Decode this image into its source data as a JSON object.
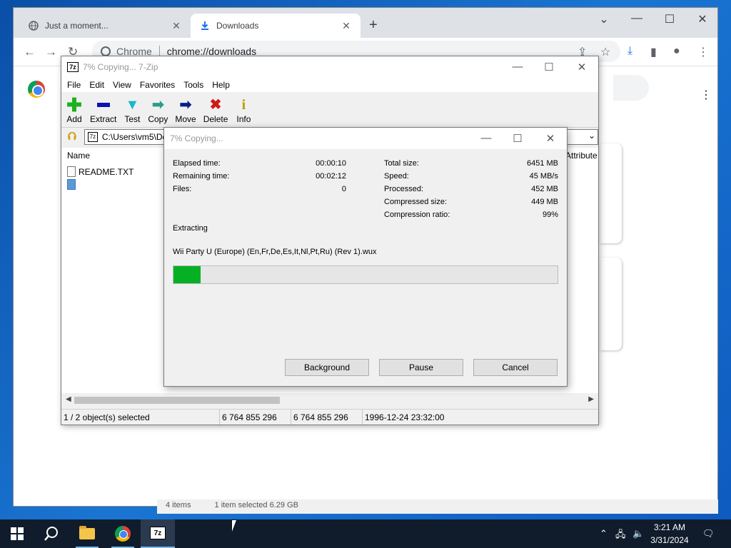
{
  "chrome": {
    "tabs": [
      {
        "label": "Just a moment...",
        "icon": "globe-icon",
        "active": false
      },
      {
        "label": "Downloads",
        "icon": "download-icon",
        "active": true
      }
    ],
    "site_label": "Chrome",
    "url": "chrome://downloads"
  },
  "explorer_behind": {
    "items": "4 items",
    "selected": "1 item selected  6.29 GB"
  },
  "zip": {
    "title": "7% Copying... 7-Zip",
    "menu": [
      "File",
      "Edit",
      "View",
      "Favorites",
      "Tools",
      "Help"
    ],
    "toolbar": [
      {
        "label": "Add",
        "icon": "add-icon",
        "color": "#1db21d"
      },
      {
        "label": "Extract",
        "icon": "extract-icon",
        "color": "#0a14b4"
      },
      {
        "label": "Test",
        "icon": "test-icon",
        "color": "#17b9c9"
      },
      {
        "label": "Copy",
        "icon": "copy-icon",
        "color": "#2f9c8a"
      },
      {
        "label": "Move",
        "icon": "move-icon",
        "color": "#0a1d8a"
      },
      {
        "label": "Delete",
        "icon": "delete-icon",
        "color": "#d01818"
      },
      {
        "label": "Info",
        "icon": "info-icon",
        "color": "#d8c01a"
      }
    ],
    "path": "C:\\Users\\vm5\\Dc",
    "columns": {
      "name": "Name",
      "attributes": "Attribute"
    },
    "files": [
      "README.TXT",
      ""
    ],
    "status": {
      "selection": "1 / 2 object(s) selected",
      "size1": "6 764 855 296",
      "size2": "6 764 855 296",
      "date": "1996-12-24 23:32:00"
    }
  },
  "dialog": {
    "title": "7% Copying...",
    "stats_left": [
      {
        "label": "Elapsed time:",
        "value": "00:00:10"
      },
      {
        "label": "Remaining time:",
        "value": "00:02:12"
      },
      {
        "label": "Files:",
        "value": "0"
      }
    ],
    "stats_right": [
      {
        "label": "Total size:",
        "value": "6451 MB"
      },
      {
        "label": "Speed:",
        "value": "45 MB/s"
      },
      {
        "label": "Processed:",
        "value": "452 MB"
      },
      {
        "label": "Compressed size:",
        "value": "449 MB"
      },
      {
        "label": "Compression ratio:",
        "value": "99%"
      }
    ],
    "operation": "Extracting",
    "filename": "Wii Party U (Europe) (En,Fr,De,Es,It,Nl,Pt,Ru) (Rev 1).wux",
    "progress_fraction": 0.07,
    "buttons": {
      "background": "Background",
      "pause": "Pause",
      "cancel": "Cancel"
    }
  },
  "taskbar": {
    "apps": [
      "start-icon",
      "search-icon",
      "file-explorer-icon",
      "chrome-icon",
      "7zip-icon"
    ],
    "time": "3:21 AM",
    "date": "3/31/2024"
  }
}
